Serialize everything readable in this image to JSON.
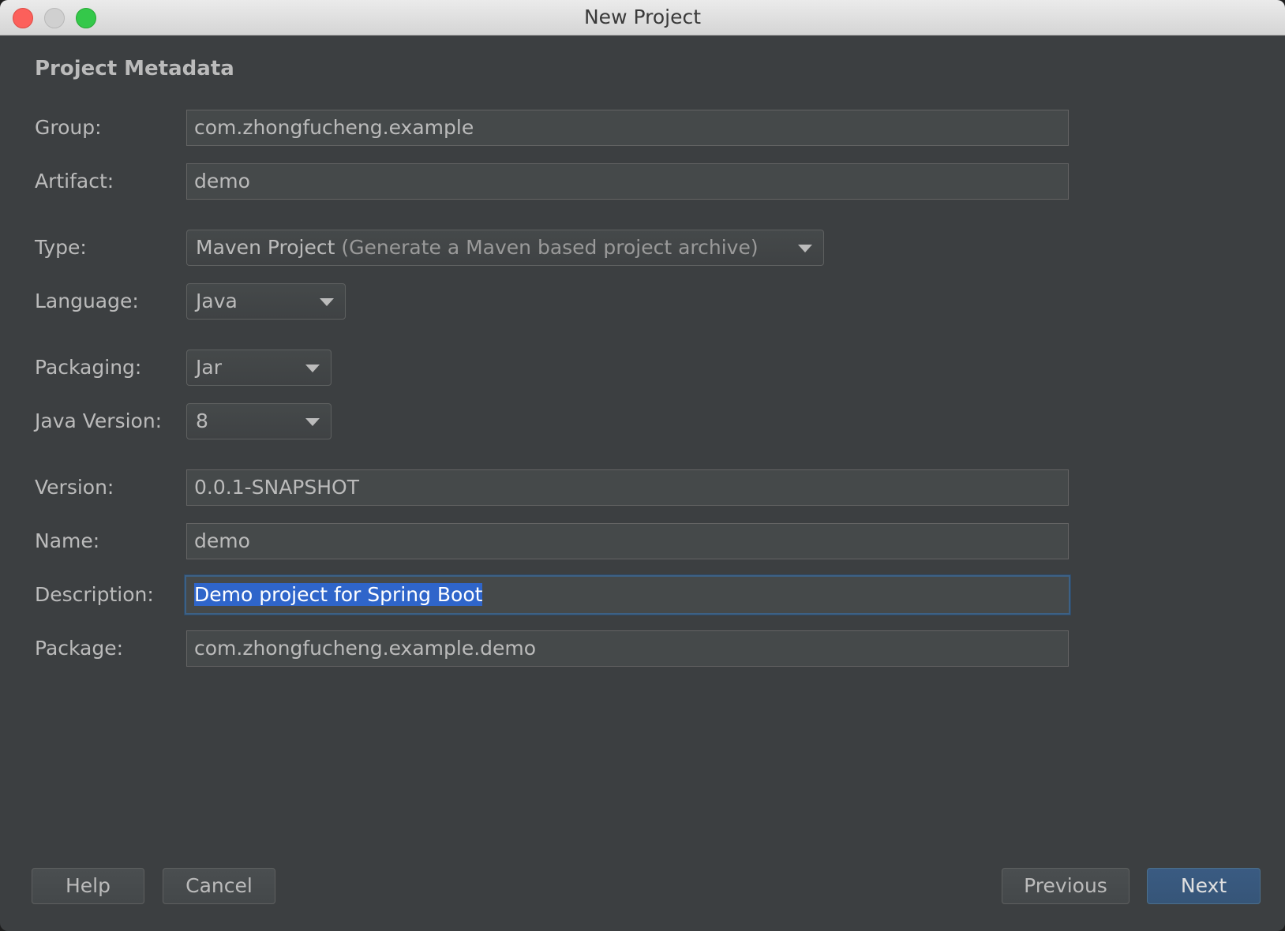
{
  "window": {
    "title": "New Project"
  },
  "section_title": "Project Metadata",
  "fields": {
    "group": {
      "label": "Group:",
      "value": "com.zhongfucheng.example"
    },
    "artifact": {
      "label": "Artifact:",
      "value": "demo"
    },
    "type": {
      "label": "Type:",
      "value": "Maven Project",
      "hint": "(Generate a Maven based project archive)"
    },
    "language": {
      "label": "Language:",
      "value": "Java"
    },
    "packaging": {
      "label": "Packaging:",
      "value": "Jar"
    },
    "java_version": {
      "label": "Java Version:",
      "value": "8"
    },
    "version": {
      "label": "Version:",
      "value": "0.0.1-SNAPSHOT"
    },
    "name": {
      "label": "Name:",
      "value": "demo"
    },
    "description": {
      "label": "Description:",
      "value": "Demo project for Spring Boot"
    },
    "package": {
      "label": "Package:",
      "value": "com.zhongfucheng.example.demo"
    }
  },
  "buttons": {
    "help": "Help",
    "cancel": "Cancel",
    "previous": "Previous",
    "next": "Next"
  },
  "colors": {
    "background": "#3c3f41",
    "field_background": "#45494a",
    "text": "#bbbbbb",
    "selection": "#2f65ca",
    "primary_button": "#365578"
  },
  "icons": {
    "close": "close-icon",
    "minimize": "minimize-icon",
    "maximize": "maximize-icon",
    "dropdown": "chevron-down-icon"
  }
}
